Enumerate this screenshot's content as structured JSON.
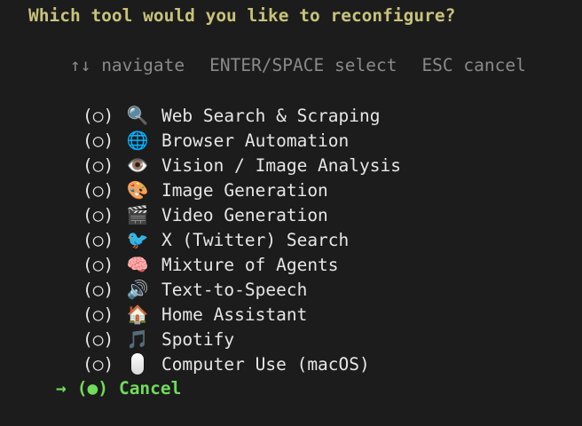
{
  "prompt": {
    "title": "Which tool would you like to reconfigure?",
    "hints": [
      "↑↓ navigate",
      "ENTER/SPACE select",
      "ESC cancel"
    ]
  },
  "options": [
    {
      "radio": "(○)",
      "icon": "🔍",
      "icon_name": "magnifier-icon",
      "label": "Web Search & Scraping"
    },
    {
      "radio": "(○)",
      "icon": "🌐",
      "icon_name": "globe-icon",
      "label": "Browser Automation"
    },
    {
      "radio": "(○)",
      "icon": "👁️",
      "icon_name": "eye-icon",
      "label": "Vision / Image Analysis"
    },
    {
      "radio": "(○)",
      "icon": "🎨",
      "icon_name": "palette-icon",
      "label": "Image Generation"
    },
    {
      "radio": "(○)",
      "icon": "🎬",
      "icon_name": "clapperboard-icon",
      "label": "Video Generation"
    },
    {
      "radio": "(○)",
      "icon": "🐦",
      "icon_name": "bird-icon",
      "label": "X (Twitter) Search"
    },
    {
      "radio": "(○)",
      "icon": "🧠",
      "icon_name": "brain-icon",
      "label": "Mixture of Agents"
    },
    {
      "radio": "(○)",
      "icon": "🔊",
      "icon_name": "speaker-icon",
      "label": "Text-to-Speech"
    },
    {
      "radio": "(○)",
      "icon": "🏠",
      "icon_name": "house-icon",
      "label": "Home Assistant"
    },
    {
      "radio": "(○)",
      "icon": "🎵",
      "icon_name": "music-note-icon",
      "label": "Spotify"
    },
    {
      "radio": "(○)",
      "icon": "",
      "icon_name": "mouse-icon",
      "label": "Computer Use (macOS)"
    }
  ],
  "selected": {
    "arrow": "→",
    "radio": "(●)",
    "label": "Cancel"
  },
  "colors": {
    "background": "#1c1c1c",
    "title": "#c8c27a",
    "hint": "#8a8a8a",
    "text": "#e6e6e6",
    "selected": "#6fdc5a"
  }
}
